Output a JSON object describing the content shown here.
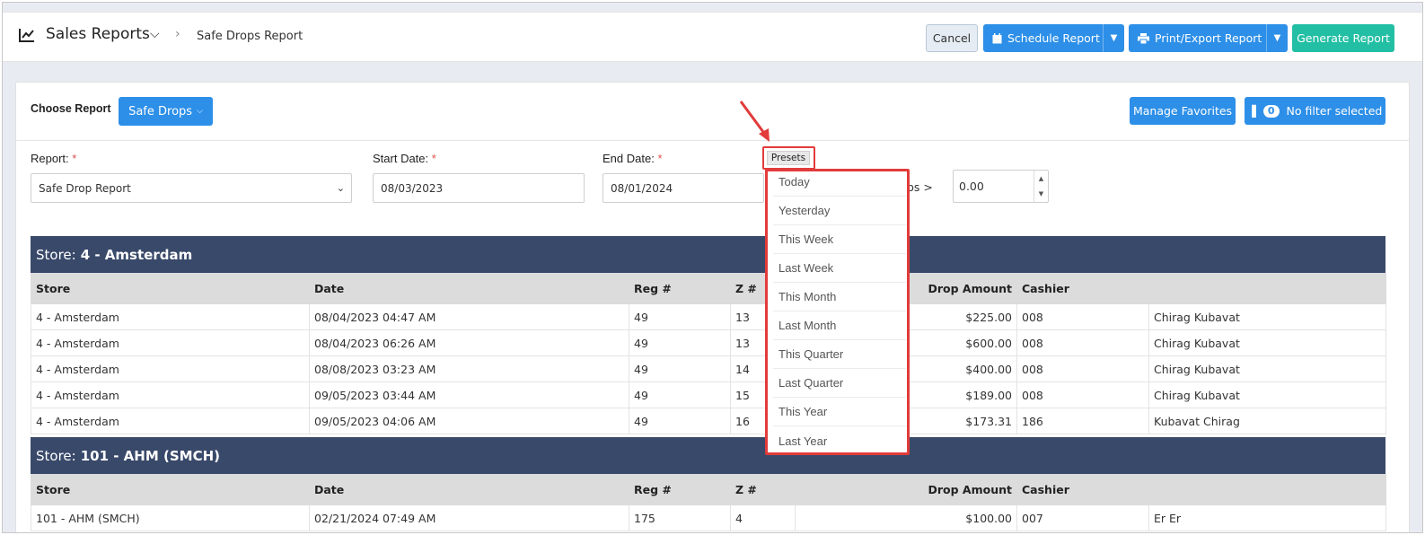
{
  "header": {
    "title": "Sales Reports",
    "breadcrumb": "Safe Drops Report",
    "buttons": {
      "cancel": "Cancel",
      "schedule": "Schedule Report",
      "print": "Print/Export Report",
      "generate": "Generate Report"
    }
  },
  "toolbar": {
    "choose_label": "Choose Report",
    "choose_value": "Safe Drops",
    "manage_favorites": "Manage Favorites",
    "filter_count": "0",
    "filter_label": "No filter selected"
  },
  "filters": {
    "report_label": "Report:",
    "report_value": "Safe Drop Report",
    "start_label": "Start Date:",
    "start_value": "08/03/2023",
    "end_label": "End Date:",
    "end_value": "08/01/2024",
    "drops_label": "ps >",
    "drops_value": "0.00",
    "required_mark": "*",
    "presets_label": "Presets"
  },
  "presets": [
    "Today",
    "Yesterday",
    "This Week",
    "Last Week",
    "This Month",
    "Last Month",
    "This Quarter",
    "Last Quarter",
    "This Year",
    "Last Year"
  ],
  "columns": [
    "Store",
    "Date",
    "Reg #",
    "Z #",
    "Drop Amount",
    "Cashier",
    ""
  ],
  "groups": [
    {
      "prefix": "Store:",
      "name": "4 - Amsterdam",
      "rows": [
        [
          "4 - Amsterdam",
          "08/04/2023 04:47 AM",
          "49",
          "13",
          "$225.00",
          "008",
          "Chirag Kubavat"
        ],
        [
          "4 - Amsterdam",
          "08/04/2023 06:26 AM",
          "49",
          "13",
          "$600.00",
          "008",
          "Chirag Kubavat"
        ],
        [
          "4 - Amsterdam",
          "08/08/2023 03:23 AM",
          "49",
          "14",
          "$400.00",
          "008",
          "Chirag Kubavat"
        ],
        [
          "4 - Amsterdam",
          "09/05/2023 03:44 AM",
          "49",
          "15",
          "$189.00",
          "008",
          "Chirag Kubavat"
        ],
        [
          "4 - Amsterdam",
          "09/05/2023 04:06 AM",
          "49",
          "16",
          "$173.31",
          "186",
          "Kubavat Chirag"
        ]
      ]
    },
    {
      "prefix": "Store:",
      "name": "101 - AHM (SMCH)",
      "rows": [
        [
          "101 - AHM (SMCH)",
          "02/21/2024 07:49 AM",
          "175",
          "4",
          "$100.00",
          "007",
          "Er Er"
        ]
      ]
    }
  ]
}
